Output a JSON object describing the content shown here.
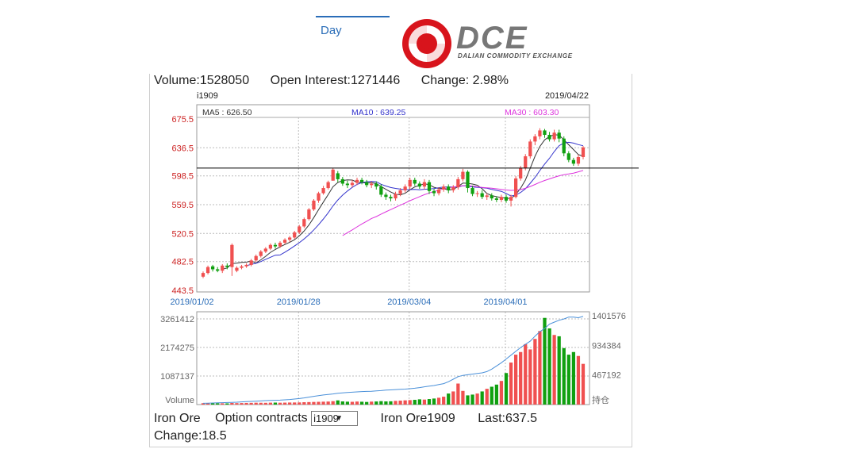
{
  "tabs": [
    {
      "label": "Day"
    }
  ],
  "logo": {
    "text": "DCE",
    "subtitle": "DALIAN COMMODITY EXCHANGE"
  },
  "stats": {
    "volume": "Volume:1528050",
    "open_interest": "Open Interest:1271446",
    "change_pct": "Change: 2.98%"
  },
  "footer": {
    "product": "Iron Ore",
    "option_label": "Option contracts",
    "selected_contract": "i1909",
    "contract_name": "Iron Ore1909",
    "last": "Last:637.5",
    "change": "Change:18.5"
  },
  "colors": {
    "up": "#f05050",
    "down": "#10a010",
    "ma5": "#333333",
    "ma10": "#3333cc",
    "ma30": "#dd33dd",
    "oi_line": "#4a90d9",
    "accent": "#2a6db8"
  },
  "chart_data": {
    "type": "candlestick",
    "contract": "i1909",
    "date": "2019/04/22",
    "ma_labels": {
      "ma5": "MA5 : 626.50",
      "ma10": "MA10 : 639.25",
      "ma30": "MA30 : 603.30"
    },
    "y_ticks": [
      "675.5",
      "636.5",
      "598.5",
      "559.5",
      "520.5",
      "482.5",
      "443.5"
    ],
    "ylim": [
      443.5,
      675.5
    ],
    "x_ticks": [
      "2019/01/02",
      "2019/01/28",
      "2019/03/04",
      "2019/04/01"
    ],
    "volume_ticks": [
      "3261412",
      "2174275",
      "1087137"
    ],
    "volume_label": "Volume",
    "oi_ticks": [
      "1401576",
      "934384",
      "467192"
    ],
    "oi_label": "持仓",
    "reference_price": 609,
    "candles": [
      [
        462,
        467,
        460,
        469
      ],
      [
        467,
        475,
        465,
        477
      ],
      [
        476,
        472,
        469,
        478
      ],
      [
        472,
        470,
        468,
        475
      ],
      [
        470,
        477,
        467,
        479
      ],
      [
        477,
        475,
        472,
        480
      ],
      [
        475,
        505,
        463,
        507
      ],
      [
        470,
        474,
        468,
        476
      ],
      [
        474,
        476,
        472,
        478
      ],
      [
        476,
        478,
        474,
        480
      ],
      [
        478,
        484,
        476,
        486
      ],
      [
        484,
        490,
        482,
        492
      ],
      [
        490,
        496,
        488,
        498
      ],
      [
        496,
        500,
        494,
        502
      ],
      [
        500,
        505,
        498,
        507
      ],
      [
        505,
        503,
        500,
        508
      ],
      [
        503,
        508,
        501,
        510
      ],
      [
        508,
        512,
        506,
        514
      ],
      [
        512,
        515,
        509,
        517
      ],
      [
        515,
        522,
        513,
        524
      ],
      [
        522,
        530,
        520,
        532
      ],
      [
        530,
        540,
        528,
        542
      ],
      [
        540,
        553,
        538,
        555
      ],
      [
        553,
        565,
        551,
        567
      ],
      [
        565,
        575,
        562,
        577
      ],
      [
        575,
        582,
        573,
        585
      ],
      [
        582,
        590,
        580,
        592
      ],
      [
        592,
        607,
        592,
        609
      ],
      [
        602,
        594,
        590,
        605
      ],
      [
        594,
        588,
        585,
        597
      ],
      [
        588,
        586,
        582,
        592
      ],
      [
        586,
        589,
        583,
        593
      ],
      [
        589,
        593,
        586,
        596
      ],
      [
        593,
        590,
        587,
        596
      ],
      [
        590,
        586,
        583,
        593
      ],
      [
        586,
        588,
        582,
        591
      ],
      [
        588,
        584,
        580,
        591
      ],
      [
        584,
        573,
        570,
        587
      ],
      [
        573,
        570,
        566,
        576
      ],
      [
        570,
        568,
        564,
        573
      ],
      [
        568,
        574,
        565,
        577
      ],
      [
        574,
        579,
        571,
        582
      ],
      [
        579,
        584,
        576,
        587
      ],
      [
        584,
        593,
        580,
        596
      ],
      [
        593,
        588,
        585,
        596
      ],
      [
        588,
        584,
        581,
        591
      ],
      [
        584,
        590,
        580,
        594
      ],
      [
        590,
        578,
        574,
        593
      ],
      [
        578,
        575,
        571,
        581
      ],
      [
        575,
        580,
        572,
        583
      ],
      [
        580,
        584,
        577,
        587
      ],
      [
        584,
        579,
        575,
        587
      ],
      [
        579,
        583,
        576,
        586
      ],
      [
        583,
        594,
        580,
        597
      ],
      [
        594,
        604,
        591,
        608
      ],
      [
        604,
        582,
        576,
        606
      ],
      [
        582,
        574,
        571,
        585
      ],
      [
        574,
        575,
        570,
        578
      ],
      [
        575,
        570,
        567,
        579
      ],
      [
        570,
        572,
        566,
        575
      ],
      [
        572,
        568,
        565,
        575
      ],
      [
        568,
        566,
        563,
        571
      ],
      [
        566,
        570,
        563,
        573
      ],
      [
        570,
        565,
        562,
        573
      ],
      [
        565,
        570,
        557,
        573
      ],
      [
        570,
        595,
        568,
        598
      ],
      [
        595,
        609,
        592,
        612
      ],
      [
        609,
        625,
        606,
        628
      ],
      [
        625,
        645,
        622,
        648
      ],
      [
        645,
        652,
        640,
        655
      ],
      [
        652,
        660,
        648,
        663
      ],
      [
        660,
        654,
        650,
        662
      ],
      [
        654,
        648,
        645,
        658
      ],
      [
        648,
        657,
        645,
        661
      ],
      [
        657,
        649,
        644,
        661
      ],
      [
        649,
        629,
        625,
        652
      ],
      [
        629,
        620,
        617,
        632
      ],
      [
        620,
        615,
        612,
        623
      ],
      [
        615,
        624,
        612,
        627
      ],
      [
        624,
        637,
        621,
        639
      ]
    ],
    "volume_values": [
      52000,
      48000,
      45000,
      50000,
      47000,
      46000,
      60000,
      55000,
      58000,
      62000,
      65000,
      70000,
      68000,
      66000,
      72000,
      75000,
      70000,
      74000,
      78000,
      80000,
      82000,
      90000,
      95000,
      100000,
      105000,
      110000,
      115000,
      130000,
      160000,
      120000,
      110000,
      105000,
      115000,
      108000,
      100000,
      112000,
      118000,
      130000,
      120000,
      125000,
      140000,
      150000,
      160000,
      170000,
      180000,
      200000,
      190000,
      210000,
      230000,
      260000,
      300000,
      420000,
      500000,
      800000,
      520000,
      350000,
      380000,
      420000,
      500000,
      600000,
      680000,
      760000,
      900000,
      1200000,
      1600000,
      1900000,
      2000000,
      2300000,
      2100000,
      2500000,
      2800000,
      3300000,
      2900000,
      2650000,
      2600000,
      2150000,
      1900000,
      2000000,
      1850000,
      1550000
    ],
    "open_interest_values": [
      20000,
      22000,
      25000,
      28000,
      30000,
      32000,
      35000,
      38000,
      42000,
      46000,
      50000,
      54000,
      58000,
      62000,
      65000,
      68000,
      70000,
      75000,
      80000,
      88000,
      95000,
      105000,
      118000,
      130000,
      142000,
      152000,
      160000,
      168000,
      178000,
      185000,
      190000,
      195000,
      200000,
      205000,
      208000,
      210000,
      215000,
      220000,
      228000,
      232000,
      236000,
      240000,
      244000,
      250000,
      258000,
      268000,
      280000,
      290000,
      300000,
      315000,
      330000,
      360000,
      400000,
      440000,
      460000,
      470000,
      480000,
      490000,
      500000,
      520000,
      560000,
      610000,
      660000,
      720000,
      780000,
      840000,
      900000,
      950000,
      1000000,
      1080000,
      1150000,
      1200000,
      1270000,
      1300000,
      1330000,
      1350000,
      1380000,
      1380000,
      1370000,
      1390000
    ]
  }
}
